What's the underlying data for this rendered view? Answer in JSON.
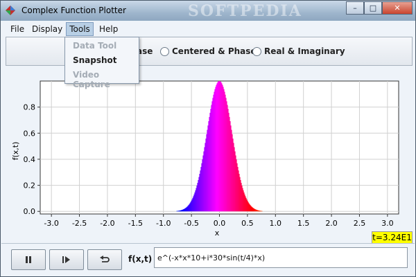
{
  "window": {
    "title": "Complex Function Plotter",
    "watermark": "SOFTPEDIA"
  },
  "caption_buttons": {
    "minimize": "–",
    "maximize": "□",
    "close": "✕"
  },
  "menu": {
    "items": [
      "File",
      "Display",
      "Tools",
      "Help"
    ],
    "active": "Tools"
  },
  "tools_menu": {
    "items": [
      {
        "label": "Data Tool",
        "enabled": false
      },
      {
        "label": "Snapshot",
        "enabled": true
      },
      {
        "label": "Video Capture",
        "enabled": false
      }
    ]
  },
  "display_options": [
    {
      "label": "ase",
      "selected": false
    },
    {
      "label": "Centered & Phase",
      "selected": false
    },
    {
      "label": "Real & Imaginary",
      "selected": false
    }
  ],
  "time_label": "t=3.24E1",
  "controls": {
    "fx_label": "f(x,t) =",
    "function_value": "e^(-x*x*10+i*30*sin(t/4)*x)",
    "buttons": [
      "pause-icon",
      "step-icon",
      "reset-icon"
    ]
  },
  "chart_data": {
    "type": "area",
    "xlabel": "x",
    "ylabel": "f(x,t)",
    "xlim": [
      -3.2,
      3.2
    ],
    "ylim": [
      -0.02,
      1.0
    ],
    "xticks": [
      -3.0,
      -2.5,
      -2.0,
      -1.5,
      -1.0,
      -0.5,
      0.0,
      0.5,
      1.0,
      1.5,
      2.0,
      2.5,
      3.0
    ],
    "yticks": [
      0.0,
      0.2,
      0.4,
      0.6,
      0.8
    ],
    "grid": true,
    "function": "exp(-10 x^2)",
    "color_encoding": "phase (rainbow hue)",
    "peak": {
      "x": 0.0,
      "y": 1.0
    }
  }
}
